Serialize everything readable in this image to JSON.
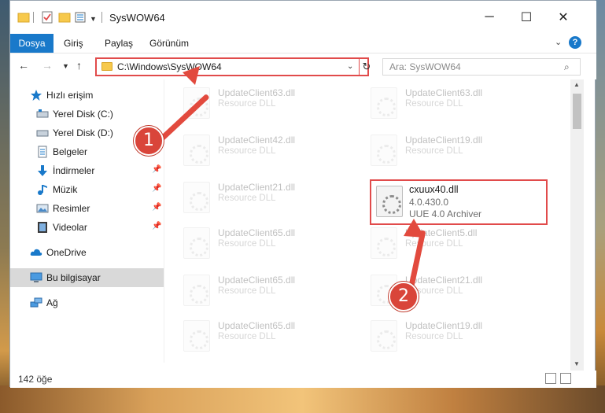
{
  "window": {
    "title": "SysWOW64",
    "minimize": "─",
    "maximize": "☐",
    "close": "✕"
  },
  "ribbon": {
    "tabs": [
      "Dosya",
      "Giriş",
      "Paylaş",
      "Görünüm"
    ],
    "help": "?"
  },
  "address": {
    "path": "C:\\Windows\\SysWOW64",
    "search_placeholder": "Ara: SysWOW64"
  },
  "sidebar": {
    "items": [
      {
        "label": "Hızlı erişim",
        "icon": "star-icon"
      },
      {
        "label": "Yerel Disk (C:)",
        "icon": "drive-icon",
        "pinned": true
      },
      {
        "label": "Yerel Disk (D:)",
        "icon": "drive-icon",
        "pinned": true
      },
      {
        "label": "Belgeler",
        "icon": "documents-icon",
        "pinned": true
      },
      {
        "label": "İndirmeler",
        "icon": "download-icon",
        "pinned": true
      },
      {
        "label": "Müzik",
        "icon": "music-icon",
        "pinned": true
      },
      {
        "label": "Resimler",
        "icon": "pictures-icon",
        "pinned": true
      },
      {
        "label": "Videolar",
        "icon": "videos-icon",
        "pinned": true
      },
      {
        "label": "OneDrive",
        "icon": "cloud-icon"
      },
      {
        "label": "Bu bilgisayar",
        "icon": "computer-icon",
        "selected": true
      },
      {
        "label": "Ağ",
        "icon": "network-icon"
      }
    ]
  },
  "files": {
    "left": [
      {
        "name": "UpdateClient63.dll",
        "desc": "Resource DLL"
      },
      {
        "name": "UpdateClient42.dll",
        "desc": "Resource DLL"
      },
      {
        "name": "UpdateClient21.dll",
        "desc": "Resource DLL"
      },
      {
        "name": "UpdateClient65.dll",
        "desc": "Resource DLL"
      },
      {
        "name": "UpdateClient65.dll",
        "desc": "Resource DLL"
      },
      {
        "name": "UpdateClient65.dll",
        "desc": "Resource DLL"
      }
    ],
    "right": [
      {
        "name": "UpdateClient63.dll",
        "desc": "Resource DLL"
      },
      {
        "name": "UpdateClient19.dll",
        "desc": "Resource DLL"
      },
      {
        "name": "UpdateClient5.dll",
        "desc": "Resource DLL"
      },
      {
        "name": "UpdateClient21.dll",
        "desc": "Resource DLL"
      },
      {
        "name": "UpdateClient19.dll",
        "desc": "Resource DLL"
      }
    ],
    "highlighted": {
      "name": "cxuux40.dll",
      "version": "4.0.430.0",
      "desc": "UUE 4.0 Archiver"
    }
  },
  "status": {
    "count": "142 öğe"
  },
  "annotations": {
    "step1": "1",
    "step2": "2",
    "color": "#e24a3e"
  }
}
